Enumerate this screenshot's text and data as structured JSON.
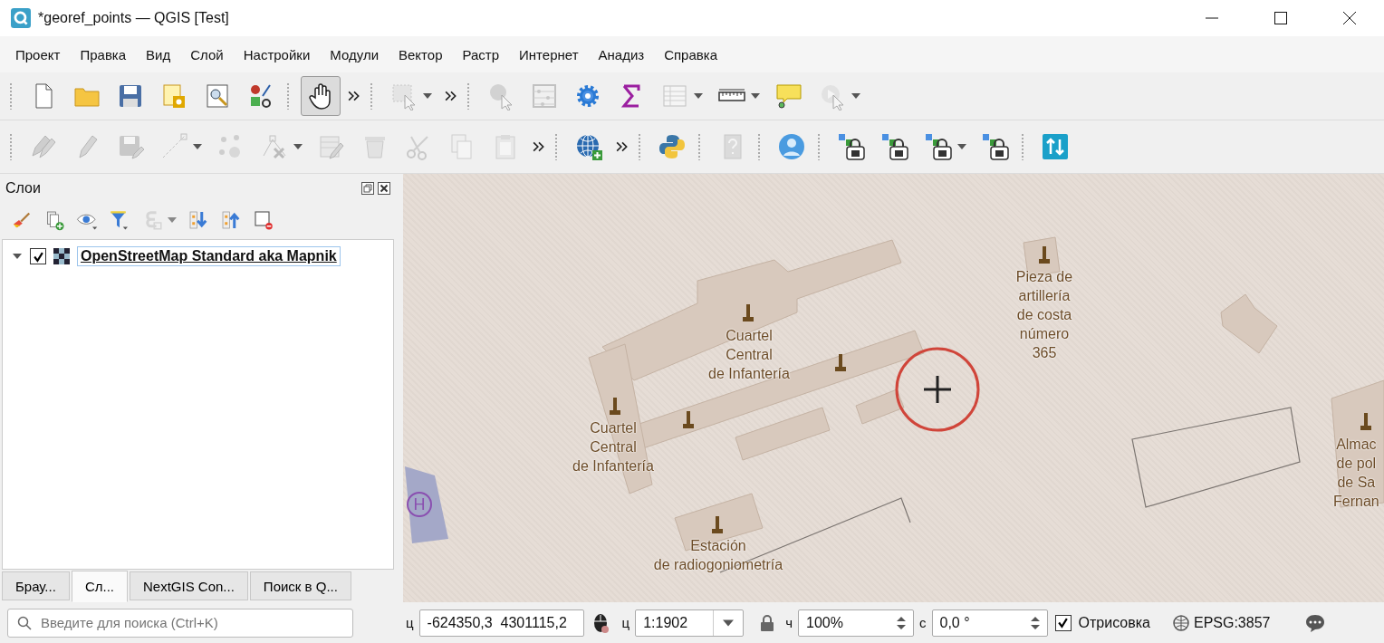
{
  "window": {
    "title": "*georef_points — QGIS [Test]"
  },
  "menu": [
    "Проект",
    "Правка",
    "Вид",
    "Слой",
    "Настройки",
    "Модули",
    "Вектор",
    "Растр",
    "Интернет",
    "Анадиз",
    "Справка"
  ],
  "toolbar_1": {
    "tools": [
      {
        "disabled": false,
        "selected": false
      },
      {
        "disabled": false,
        "selected": false
      },
      {
        "disabled": false,
        "selected": false
      },
      {
        "disabled": false,
        "selected": false
      },
      {
        "disabled": false,
        "selected": false
      },
      {
        "disabled": false,
        "selected": false
      },
      {
        "disabled": false,
        "selected": true
      },
      {
        "disabled": true,
        "selected": false
      },
      {
        "disabled": true,
        "selected": false
      },
      {
        "disabled": true,
        "selected": false
      },
      {
        "disabled": false,
        "selected": false
      },
      {
        "disabled": false,
        "selected": false
      },
      {
        "disabled": true,
        "selected": false
      },
      {
        "disabled": false,
        "selected": false
      },
      {
        "disabled": false,
        "selected": false
      },
      {
        "disabled": true,
        "selected": false
      }
    ]
  },
  "toolbar_2": {
    "tools": [
      {
        "disabled": true,
        "selected": false
      },
      {
        "disabled": true,
        "selected": false
      },
      {
        "disabled": true,
        "selected": false
      },
      {
        "disabled": true,
        "selected": false
      },
      {
        "disabled": true,
        "selected": false
      },
      {
        "disabled": true,
        "selected": false
      },
      {
        "disabled": true,
        "selected": false
      },
      {
        "disabled": true,
        "selected": false
      },
      {
        "disabled": true,
        "selected": false
      },
      {
        "disabled": true,
        "selected": false
      },
      {
        "disabled": true,
        "selected": false
      },
      {
        "disabled": false,
        "selected": false
      },
      {
        "disabled": false,
        "selected": false
      },
      {
        "disabled": true,
        "selected": false
      },
      {
        "disabled": false,
        "selected": false
      },
      {
        "disabled": false,
        "selected": false
      },
      {
        "disabled": false,
        "selected": false
      },
      {
        "disabled": false,
        "selected": false
      },
      {
        "disabled": false,
        "selected": false
      },
      {
        "disabled": false,
        "selected": false
      }
    ]
  },
  "layers_panel": {
    "title": "Слои",
    "tools": [
      {
        "disabled": false
      },
      {
        "disabled": false
      },
      {
        "disabled": false
      },
      {
        "disabled": false
      },
      {
        "disabled": true
      },
      {
        "disabled": false
      },
      {
        "disabled": false
      },
      {
        "disabled": false
      }
    ],
    "layers": [
      {
        "name": "OpenStreetMap Standard aka Mapnik",
        "expanded": true,
        "checked": true,
        "selected": true
      }
    ]
  },
  "dock_tabs": [
    {
      "label": "Брау...",
      "selected": false
    },
    {
      "label": "Сл...",
      "selected": true
    },
    {
      "label": "NextGIS Con...",
      "selected": false
    },
    {
      "label": "Поиск в Q...",
      "selected": false
    }
  ],
  "map": {
    "labels": [
      "Cuartel\nCentral\nde Infantería",
      "Cuartel\nCentral\nde Infantería",
      "Pieza de\nartillería\nde costa\nnúmero\n365",
      "Estación\nde radiogoniometría",
      "Almac\nde pol\nde Sa\nFernan"
    ],
    "heliport_symbol": "H"
  },
  "status_bar": {
    "search": {
      "placeholder": "Введите для поиска (Ctrl+K)"
    },
    "coordinate": {
      "label": "ц",
      "value": "-624350,3  4301115,2"
    },
    "scale": {
      "label": "ц",
      "value": "1:1902"
    },
    "magnifier": {
      "label": "ч",
      "value": "100%"
    },
    "rotation": {
      "label": "с",
      "value": "0,0 °"
    },
    "render": {
      "label": "Отрисовка",
      "checked": true
    },
    "crs": "EPSG:3857"
  }
}
